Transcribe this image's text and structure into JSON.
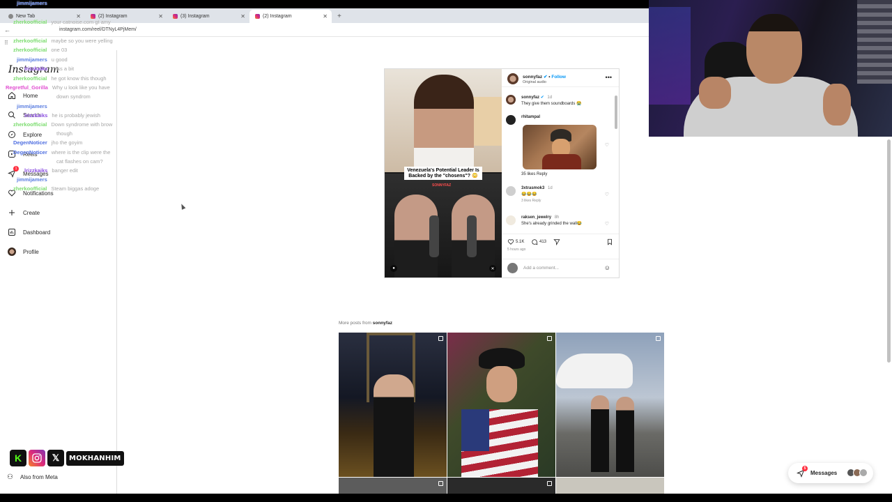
{
  "browser": {
    "tabs": [
      {
        "label": "New Tab",
        "active": false
      },
      {
        "label": "(2) Instagram",
        "active": false
      },
      {
        "label": "(3) Instagram",
        "active": false
      },
      {
        "label": "(2) Instagram",
        "active": true
      }
    ],
    "new_tab_symbol": "+",
    "url": "instagram.com/reel/DTNyL4PjMem/"
  },
  "sidebar": {
    "logo": "Instagram",
    "items": [
      {
        "label": "Home",
        "icon": "home-icon"
      },
      {
        "label": "Search",
        "icon": "search-icon"
      },
      {
        "label": "Explore",
        "icon": "compass-icon"
      },
      {
        "label": "Reels",
        "icon": "reels-icon"
      },
      {
        "label": "Messages",
        "icon": "messenger-icon",
        "badge": "1"
      },
      {
        "label": "Notifications",
        "icon": "heart-icon"
      },
      {
        "label": "Create",
        "icon": "plus-icon"
      },
      {
        "label": "Dashboard",
        "icon": "dashboard-icon"
      },
      {
        "label": "Profile",
        "icon": "avatar-icon"
      }
    ],
    "also_from_meta": "Also from Meta"
  },
  "chat": [
    {
      "user": "jimmijamers",
      "msg": "",
      "color": "#5a7de0"
    },
    {
      "user": "zherkoofficial",
      "msg": "your catnoise.com gt amy",
      "color": "#7bdc6e"
    },
    {
      "user": "zherkoofficial",
      "msg": "maybe so you were yelling",
      "color": "#7bdc6e"
    },
    {
      "user": "zherkoofficial",
      "msg": "one 03",
      "color": "#7bdc6e"
    },
    {
      "user": "jimmijamers",
      "msg": "u good",
      "color": "#5a7de0"
    },
    {
      "user": "lrizzkaiks",
      "msg": "miss a bit",
      "color": "#8a4de0"
    },
    {
      "user": "zherkoofficial",
      "msg": "he got know this though",
      "color": "#7bdc6e"
    },
    {
      "user": "Regretful_Gorilla",
      "msg": "Why u look like you have",
      "color": "#e04dd0"
    },
    {
      "user": "",
      "msg": "down syndrom",
      "color": "#7bdc6e"
    },
    {
      "user": "jimmijamers",
      "msg": "",
      "color": "#5a7de0"
    },
    {
      "user": "lrizzkaiks",
      "msg": "he is probably jewish",
      "color": "#8a4de0"
    },
    {
      "user": "zherkoofficial",
      "msg": "Down syndrome with brow",
      "color": "#7bdc6e"
    },
    {
      "user": "",
      "msg": "though",
      "color": "#7bdc6e"
    },
    {
      "user": "DegenNoticer",
      "msg": "jho the goyim",
      "color": "#4d6de0"
    },
    {
      "user": "DegenNoticer",
      "msg": "where is the clip were the",
      "color": "#4d6de0"
    },
    {
      "user": "",
      "msg": "cat flashes on cam?",
      "color": "#4d6de0"
    },
    {
      "user": "lrizzkaiks",
      "msg": "banger edit",
      "color": "#8a4de0"
    },
    {
      "user": "jimmijamers",
      "msg": "",
      "color": "#5a7de0"
    },
    {
      "user": "zherkoofficial",
      "msg": "Steam biggas adoge",
      "color": "#7bdc6e"
    }
  ],
  "post": {
    "username": "sonnyfaz",
    "verified_mark": "✔",
    "follow": "Follow",
    "audio": "Original audio",
    "caption_user": "sonnyfaz",
    "caption_time": "1d",
    "caption_text": "They give them soundboards 😭",
    "media_caption": "Venezuela's Potential Leader Is Backed by the \"chosens\"? 😳",
    "media_watermark": "SONNYFAZ",
    "comments": [
      {
        "user": "rhitampal",
        "time": "",
        "text": "",
        "meta": "35 likes   Reply",
        "has_gif": true
      },
      {
        "user": "3xtrasmok3",
        "time": "1d",
        "text": "😂😂😂",
        "meta": "3 likes   Reply"
      },
      {
        "user": "raksen_jewelry",
        "time": "8h",
        "text": "She's already grinded the wall😂",
        "meta": ""
      }
    ],
    "likes": "5.1K",
    "comments_count": "413",
    "time_ago": "5 hours ago",
    "add_comment_placeholder": "Add a comment..."
  },
  "more_posts": {
    "prefix": "More posts from",
    "user": "sonnyfaz"
  },
  "messages_pill": {
    "label": "Messages",
    "badge": "5"
  },
  "stream": {
    "handle": "MOKHANHIM",
    "kick_letter": "K",
    "x_letter": "𝕏"
  }
}
